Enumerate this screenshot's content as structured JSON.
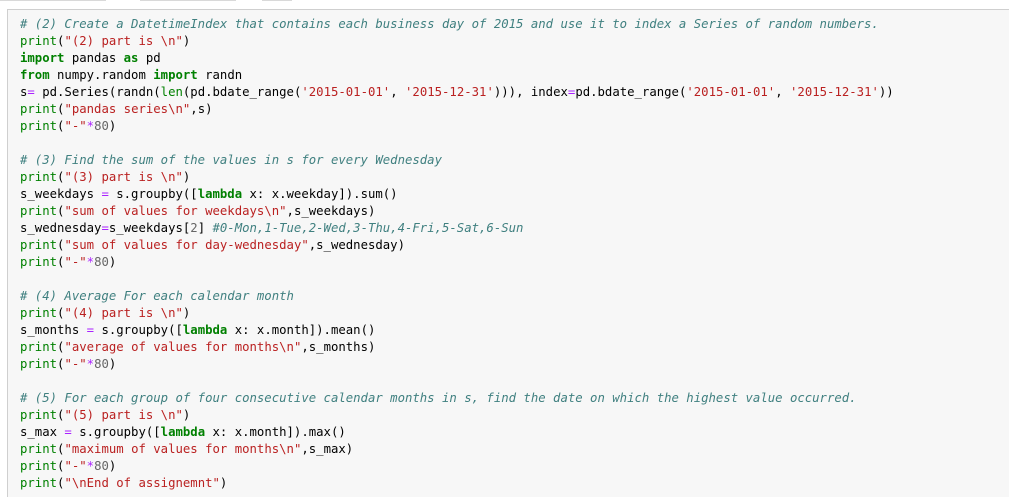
{
  "cell": {
    "lines": [
      {
        "parts": [
          {
            "k": "cm",
            "t": "# (2) Create a DatetimeIndex that contains each business day of 2015 and use it to index a Series of random numbers."
          }
        ]
      },
      {
        "parts": [
          {
            "k": "bi",
            "t": "print"
          },
          {
            "k": "tx",
            "t": "("
          },
          {
            "k": "st",
            "t": "\"(2) part is \\n\""
          },
          {
            "k": "tx",
            "t": ")"
          }
        ]
      },
      {
        "parts": [
          {
            "k": "kw",
            "t": "import"
          },
          {
            "k": "tx",
            "t": " pandas "
          },
          {
            "k": "kw",
            "t": "as"
          },
          {
            "k": "tx",
            "t": " pd"
          }
        ]
      },
      {
        "parts": [
          {
            "k": "kw",
            "t": "from"
          },
          {
            "k": "tx",
            "t": " numpy.random "
          },
          {
            "k": "kw",
            "t": "import"
          },
          {
            "k": "tx",
            "t": " randn"
          }
        ]
      },
      {
        "parts": [
          {
            "k": "tx",
            "t": "s"
          },
          {
            "k": "op",
            "t": "="
          },
          {
            "k": "tx",
            "t": " pd.Series(randn("
          },
          {
            "k": "bi",
            "t": "len"
          },
          {
            "k": "tx",
            "t": "(pd.bdate_range("
          },
          {
            "k": "st",
            "t": "'2015-01-01'"
          },
          {
            "k": "tx",
            "t": ", "
          },
          {
            "k": "st",
            "t": "'2015-12-31'"
          },
          {
            "k": "tx",
            "t": "))), index"
          },
          {
            "k": "op",
            "t": "="
          },
          {
            "k": "tx",
            "t": "pd.bdate_range("
          },
          {
            "k": "st",
            "t": "'2015-01-01'"
          },
          {
            "k": "tx",
            "t": ", "
          },
          {
            "k": "st",
            "t": "'2015-12-31'"
          },
          {
            "k": "tx",
            "t": "))"
          }
        ]
      },
      {
        "parts": [
          {
            "k": "bi",
            "t": "print"
          },
          {
            "k": "tx",
            "t": "("
          },
          {
            "k": "st",
            "t": "\"pandas series\\n\""
          },
          {
            "k": "tx",
            "t": ",s)"
          }
        ]
      },
      {
        "parts": [
          {
            "k": "bi",
            "t": "print"
          },
          {
            "k": "tx",
            "t": "("
          },
          {
            "k": "st",
            "t": "\"-\""
          },
          {
            "k": "op",
            "t": "*"
          },
          {
            "k": "nm",
            "t": "80"
          },
          {
            "k": "tx",
            "t": ")"
          }
        ]
      },
      {
        "parts": []
      },
      {
        "parts": [
          {
            "k": "cm",
            "t": "# (3) Find the sum of the values in s for every Wednesday"
          }
        ]
      },
      {
        "parts": [
          {
            "k": "bi",
            "t": "print"
          },
          {
            "k": "tx",
            "t": "("
          },
          {
            "k": "st",
            "t": "\"(3) part is \\n\""
          },
          {
            "k": "tx",
            "t": ")"
          }
        ]
      },
      {
        "parts": [
          {
            "k": "tx",
            "t": "s_weekdays "
          },
          {
            "k": "op",
            "t": "="
          },
          {
            "k": "tx",
            "t": " s.groupby(["
          },
          {
            "k": "kw",
            "t": "lambda"
          },
          {
            "k": "tx",
            "t": " x: x.weekday]).sum()"
          }
        ]
      },
      {
        "parts": [
          {
            "k": "bi",
            "t": "print"
          },
          {
            "k": "tx",
            "t": "("
          },
          {
            "k": "st",
            "t": "\"sum of values for weekdays\\n\""
          },
          {
            "k": "tx",
            "t": ",s_weekdays)"
          }
        ]
      },
      {
        "parts": [
          {
            "k": "tx",
            "t": "s_wednesday"
          },
          {
            "k": "op",
            "t": "="
          },
          {
            "k": "tx",
            "t": "s_weekdays["
          },
          {
            "k": "nm",
            "t": "2"
          },
          {
            "k": "tx",
            "t": "] "
          },
          {
            "k": "cm",
            "t": "#0-Mon,1-Tue,2-Wed,3-Thu,4-Fri,5-Sat,6-Sun"
          }
        ]
      },
      {
        "parts": [
          {
            "k": "bi",
            "t": "print"
          },
          {
            "k": "tx",
            "t": "("
          },
          {
            "k": "st",
            "t": "\"sum of values for day-wednesday\""
          },
          {
            "k": "tx",
            "t": ",s_wednesday)"
          }
        ]
      },
      {
        "parts": [
          {
            "k": "bi",
            "t": "print"
          },
          {
            "k": "tx",
            "t": "("
          },
          {
            "k": "st",
            "t": "\"-\""
          },
          {
            "k": "op",
            "t": "*"
          },
          {
            "k": "nm",
            "t": "80"
          },
          {
            "k": "tx",
            "t": ")"
          }
        ]
      },
      {
        "parts": []
      },
      {
        "parts": [
          {
            "k": "cm",
            "t": "# (4) Average For each calendar month"
          }
        ]
      },
      {
        "parts": [
          {
            "k": "bi",
            "t": "print"
          },
          {
            "k": "tx",
            "t": "("
          },
          {
            "k": "st",
            "t": "\"(4) part is \\n\""
          },
          {
            "k": "tx",
            "t": ")"
          }
        ]
      },
      {
        "parts": [
          {
            "k": "tx",
            "t": "s_months "
          },
          {
            "k": "op",
            "t": "="
          },
          {
            "k": "tx",
            "t": " s.groupby(["
          },
          {
            "k": "kw",
            "t": "lambda"
          },
          {
            "k": "tx",
            "t": " x: x.month]).mean()"
          }
        ]
      },
      {
        "parts": [
          {
            "k": "bi",
            "t": "print"
          },
          {
            "k": "tx",
            "t": "("
          },
          {
            "k": "st",
            "t": "\"average of values for months\\n\""
          },
          {
            "k": "tx",
            "t": ",s_months)"
          }
        ]
      },
      {
        "parts": [
          {
            "k": "bi",
            "t": "print"
          },
          {
            "k": "tx",
            "t": "("
          },
          {
            "k": "st",
            "t": "\"-\""
          },
          {
            "k": "op",
            "t": "*"
          },
          {
            "k": "nm",
            "t": "80"
          },
          {
            "k": "tx",
            "t": ")"
          }
        ]
      },
      {
        "parts": []
      },
      {
        "parts": [
          {
            "k": "cm",
            "t": "# (5) For each group of four consecutive calendar months in s, find the date on which the highest value occurred."
          }
        ]
      },
      {
        "parts": [
          {
            "k": "bi",
            "t": "print"
          },
          {
            "k": "tx",
            "t": "("
          },
          {
            "k": "st",
            "t": "\"(5) part is \\n\""
          },
          {
            "k": "tx",
            "t": ")"
          }
        ]
      },
      {
        "parts": [
          {
            "k": "tx",
            "t": "s_max "
          },
          {
            "k": "op",
            "t": "="
          },
          {
            "k": "tx",
            "t": " s.groupby(["
          },
          {
            "k": "kw",
            "t": "lambda"
          },
          {
            "k": "tx",
            "t": " x: x.month]).max()"
          }
        ]
      },
      {
        "parts": [
          {
            "k": "bi",
            "t": "print"
          },
          {
            "k": "tx",
            "t": "("
          },
          {
            "k": "st",
            "t": "\"maximum of values for months\\n\""
          },
          {
            "k": "tx",
            "t": ",s_max)"
          }
        ]
      },
      {
        "parts": [
          {
            "k": "bi",
            "t": "print"
          },
          {
            "k": "tx",
            "t": "("
          },
          {
            "k": "st",
            "t": "\"-\""
          },
          {
            "k": "op",
            "t": "*"
          },
          {
            "k": "nm",
            "t": "80"
          },
          {
            "k": "tx",
            "t": ")"
          }
        ]
      },
      {
        "parts": [
          {
            "k": "bi",
            "t": "print"
          },
          {
            "k": "tx",
            "t": "("
          },
          {
            "k": "st",
            "t": "\"\\nEnd of assignemnt\""
          },
          {
            "k": "tx",
            "t": ")"
          }
        ]
      }
    ]
  },
  "colors": {
    "comment": "#408080",
    "keyword": "#008000",
    "string": "#ba2121",
    "number": "#666666",
    "operator": "#aa22ff",
    "cell_background": "#f7f7f7"
  }
}
